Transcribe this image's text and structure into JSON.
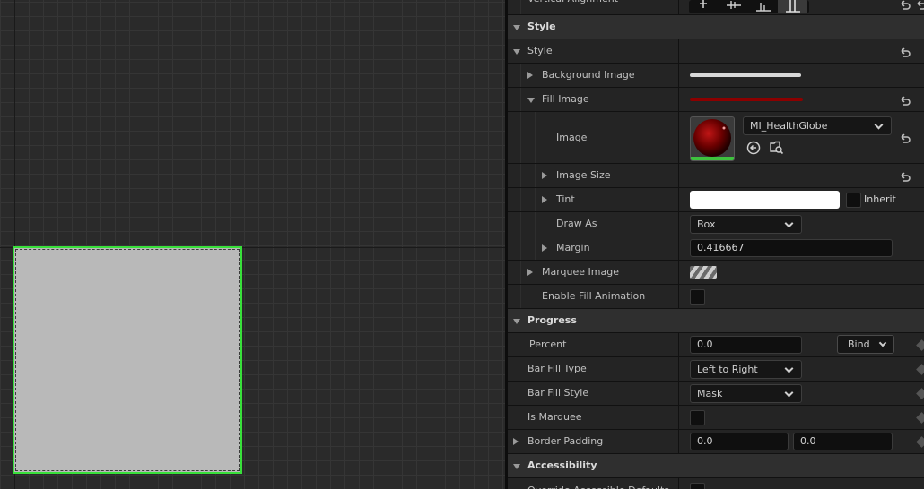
{
  "panel": {
    "rows": [
      {
        "label": "Vertical Alignment"
      },
      {
        "label": "Style"
      },
      {
        "label": "Style"
      },
      {
        "label": "Background Image"
      },
      {
        "label": "Fill Image"
      },
      {
        "label": "Image",
        "asset": "MI_HealthGlobe"
      },
      {
        "label": "Image Size"
      },
      {
        "label": "Tint",
        "inherit": "Inherit"
      },
      {
        "label": "Draw As",
        "value": "Box"
      },
      {
        "label": "Margin",
        "value": "0.416667"
      },
      {
        "label": "Marquee Image"
      },
      {
        "label": "Enable Fill Animation"
      },
      {
        "label": "Progress"
      },
      {
        "label": "Percent",
        "value": "0.0",
        "bind": "Bind"
      },
      {
        "label": "Bar Fill Type",
        "value": "Left to Right"
      },
      {
        "label": "Bar Fill Style",
        "value": "Mask"
      },
      {
        "label": "Is Marquee"
      },
      {
        "label": "Border Padding",
        "x": "0.0",
        "y": "0.0"
      },
      {
        "label": "Accessibility"
      },
      {
        "label": "Override Accessible Defaults"
      }
    ]
  },
  "colors": {
    "selection": "#38e03a",
    "widget": "#b9b9b9",
    "fill_image": "#8c0000",
    "tint": "#ffffff"
  },
  "icons": {
    "alignment": [
      "align-top-icon",
      "align-center-icon",
      "align-bottom-icon",
      "align-fill-icon"
    ],
    "reset": "reset-arrow-icon",
    "asset_actions": [
      "use-selected-asset-icon",
      "browse-asset-icon"
    ]
  }
}
